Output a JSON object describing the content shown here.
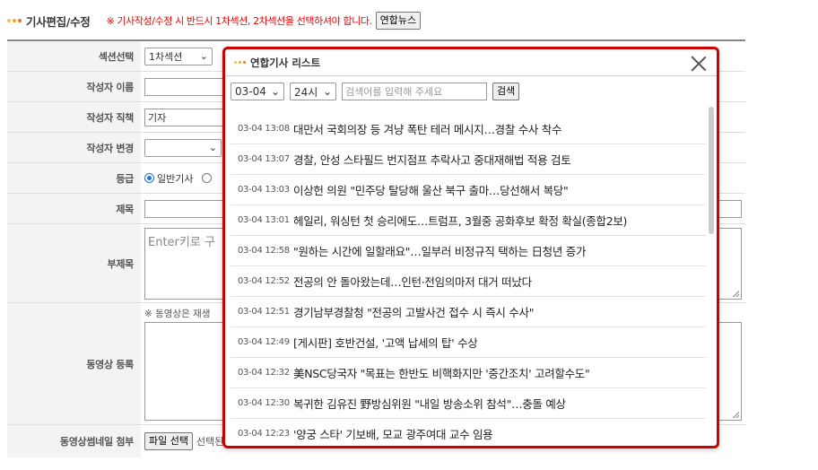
{
  "header": {
    "title": "기사편집/수정",
    "notice": "※ 기사작성/수정 시 반드시 1차섹션, 2차섹션을 선택하셔야 합니다.",
    "yonhap_button": "연합뉴스"
  },
  "form": {
    "section_label": "섹션선택",
    "section_value": "1차섹션",
    "author_name_label": "작성자 이름",
    "author_name_value": "",
    "author_role_label": "작성자 직책",
    "author_role_value": "기자",
    "author_change_label": "작성자 변경",
    "author_change_value": "",
    "grade_label": "등급",
    "grade_option1": "일반기사",
    "title_label": "제목",
    "subtitle_label": "부제목",
    "subtitle_placeholder": "Enter키로 구",
    "video_label": "동영상 등록",
    "video_note": "※ 동영상은 재생",
    "thumb_label": "동영상썸네일 첨부",
    "file_button": "파일 선택",
    "file_status": "선택된 파일 없음"
  },
  "popup": {
    "title": "연합기사 리스트",
    "date_select": "03-04",
    "hour_select": "24시",
    "search_placeholder": "검색어를 입력해 주세요",
    "search_button": "검색",
    "items": [
      {
        "time": "03-04 13:08",
        "title": "대만서 국회의장 등 겨냥 폭탄 테러 메시지…경찰 수사 착수"
      },
      {
        "time": "03-04 13:07",
        "title": "경찰, 안성 스타필드 번지점프 추락사고 중대재해법 적용 검토"
      },
      {
        "time": "03-04 13:03",
        "title": "이상헌 의원 \"민주당 탈당해 울산 북구 출마…당선해서 복당\""
      },
      {
        "time": "03-04 13:01",
        "title": "헤일리, 워싱턴 첫 승리에도…트럼프, 3월중 공화후보 확정 확실(종합2보)"
      },
      {
        "time": "03-04 12:58",
        "title": "\"원하는 시간에 일할래요\"…일부러 비정규직 택하는 日청년 증가"
      },
      {
        "time": "03-04 12:52",
        "title": "전공의 안 돌아왔는데…인턴·전임의마저 대거 떠났다"
      },
      {
        "time": "03-04 12:51",
        "title": "경기남부경찰청 \"전공의 고발사건 접수 시 즉시 수사\""
      },
      {
        "time": "03-04 12:49",
        "title": "[게시판] 호반건설, '고액 납세의 탑' 수상"
      },
      {
        "time": "03-04 12:32",
        "title": "美NSC당국자 \"목표는 한반도 비핵화지만 '중간조치' 고려할수도\""
      },
      {
        "time": "03-04 12:30",
        "title": "복귀한 김유진 野방심위원 \"내일 방송소위 참석\"…충돌 예상"
      },
      {
        "time": "03-04 12:23",
        "title": "'양궁 스타' 기보배, 모교 광주여대 교수 임용"
      }
    ]
  },
  "colors": {
    "accent_red": "#cc0000",
    "notice_red": "#e00000",
    "dot_orange": "#f5a623",
    "dot_red": "#d0021b"
  }
}
